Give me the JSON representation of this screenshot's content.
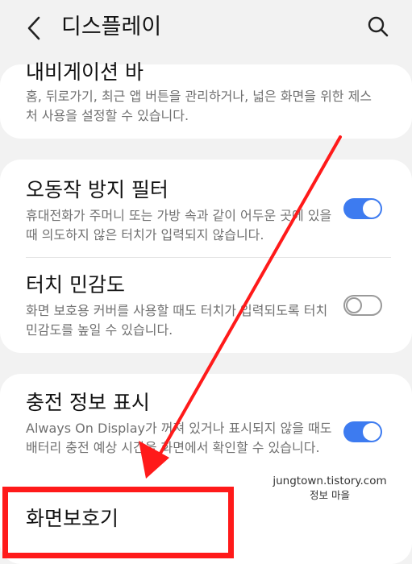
{
  "header": {
    "title": "디스플레이",
    "back_icon": "back-arrow-icon",
    "search_icon": "search-icon"
  },
  "items": {
    "navigation_bar": {
      "title": "내비게이션 바",
      "description": "홈, 뒤로가기, 최근 앱 버튼을 관리하거나, 넓은 화면을 위한 제스처 사용을 설정할 수 있습니다."
    },
    "accidental_touch": {
      "title": "오동작 방지 필터",
      "description": "휴대전화가 주머니 또는 가방 속과 같이 어두운 곳에 있을 때 의도하지 않은 터치가 입력되지 않습니다.",
      "enabled": true
    },
    "touch_sensitivity": {
      "title": "터치 민감도",
      "description": "화면 보호용 커버를 사용할 때도 터치가 입력되도록 터치 민감도를 높일 수 있습니다.",
      "enabled": false
    },
    "charging_info": {
      "title": "충전 정보 표시",
      "description": "Always On Display가 꺼져 있거나 표시되지 않을 때도 배터리 충전 예상 시간을 화면에서 확인할 수 있습니다.",
      "enabled": true
    },
    "screen_saver": {
      "title": "화면보호기"
    }
  },
  "watermark": {
    "line1": "jungtown.tistory.com",
    "line2": "정보 마을"
  },
  "colors": {
    "background": "#f2f2f2",
    "card": "#ffffff",
    "toggle_on": "#3d7bf0",
    "annotation_red": "#ff1a1a"
  }
}
